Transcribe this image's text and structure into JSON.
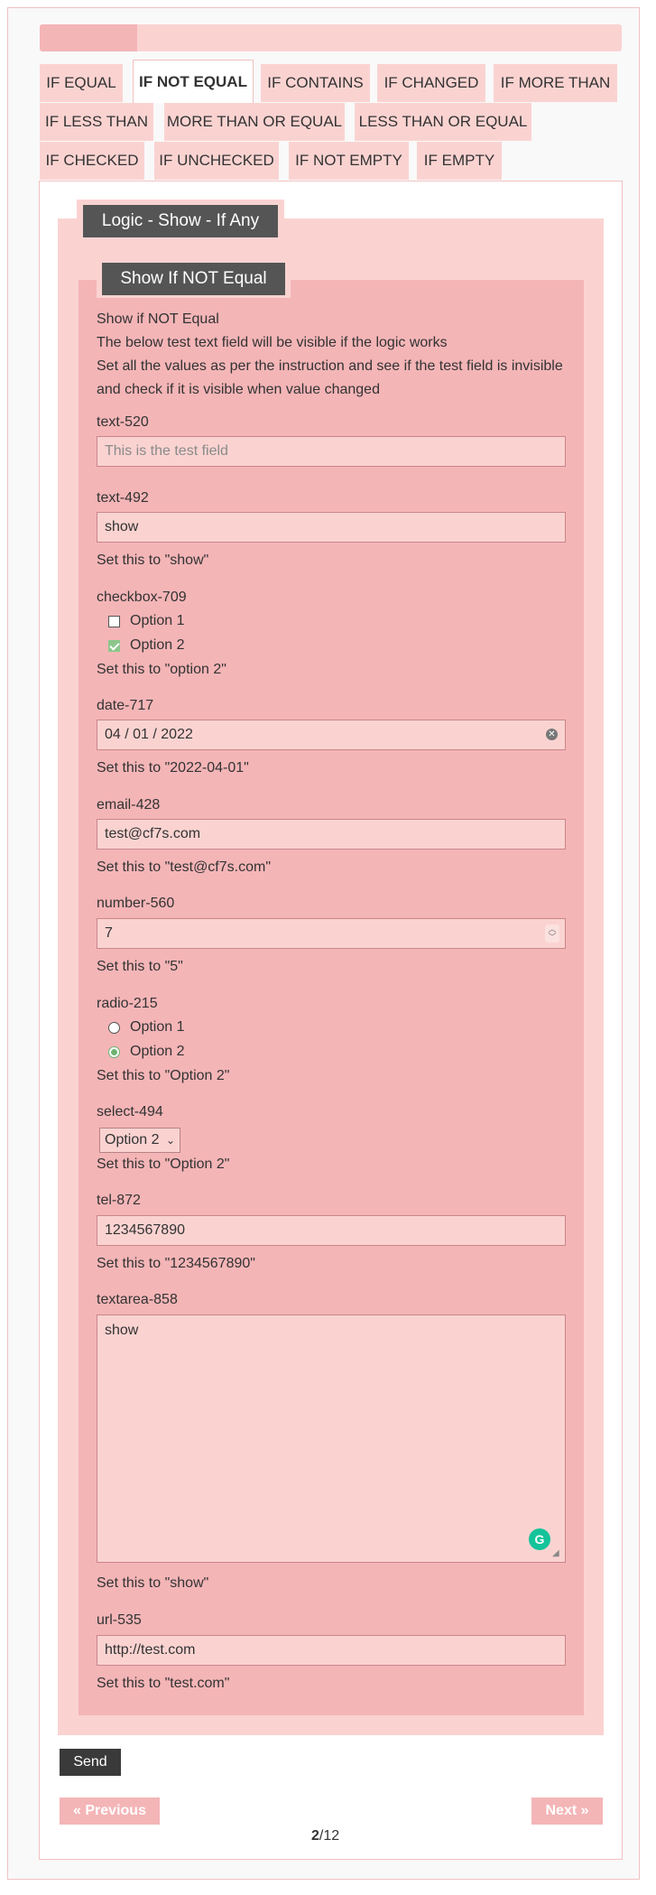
{
  "progress": {
    "percent": 16.7
  },
  "tabs": [
    {
      "label": "IF EQUAL"
    },
    {
      "label": "IF NOT EQUAL"
    },
    {
      "label": "IF CONTAINS"
    },
    {
      "label": "IF CHANGED"
    },
    {
      "label": "IF MORE THAN"
    },
    {
      "label": "IF LESS THAN"
    },
    {
      "label": "MORE THAN OR EQUAL"
    },
    {
      "label": "LESS THAN OR EQUAL"
    },
    {
      "label": "IF CHECKED"
    },
    {
      "label": "IF UNCHECKED"
    },
    {
      "label": "IF NOT EMPTY"
    },
    {
      "label": "IF EMPTY"
    }
  ],
  "active_tab": "IF NOT EQUAL",
  "outer_legend": "Logic - Show - If Any",
  "inner_legend": "Show If NOT Equal",
  "intro": {
    "line1": "Show if NOT Equal",
    "line2": "The below test text field will be visible if the logic works",
    "line3": "Set all the values as per the instruction and see if the test field is invisible",
    "line4": "and check if it is visible when value changed"
  },
  "fields": {
    "text520": {
      "label": "text-520",
      "placeholder": "This is the test field"
    },
    "text492": {
      "label": "text-492",
      "value": "show",
      "hint": "Set this to \"show\""
    },
    "checkbox709": {
      "label": "checkbox-709",
      "option1": "Option 1",
      "option2": "Option 2",
      "hint": "Set this to \"option 2\""
    },
    "date717": {
      "label": "date-717",
      "value": "04 / 01 / 2022",
      "hint": "Set this to \"2022-04-01\""
    },
    "email428": {
      "label": "email-428",
      "value": "test@cf7s.com",
      "hint": "Set this to \"test@cf7s.com\""
    },
    "number560": {
      "label": "number-560",
      "value": "7",
      "hint": "Set this to \"5\""
    },
    "radio215": {
      "label": "radio-215",
      "option1": "Option 1",
      "option2": "Option 2",
      "hint": "Set this to \"Option 2\""
    },
    "select494": {
      "label": "select-494",
      "value": "Option 2",
      "hint": "Set this to \"Option 2\""
    },
    "tel872": {
      "label": "tel-872",
      "value": "1234567890",
      "hint": "Set this to \"1234567890\""
    },
    "textarea858": {
      "label": "textarea-858",
      "value": "show",
      "hint": "Set this to \"show\""
    },
    "url535": {
      "label": "url-535",
      "value": "http://test.com",
      "hint": "Set this to \"test.com\""
    }
  },
  "buttons": {
    "send": "Send",
    "previous": "« Previous",
    "next": "Next »"
  },
  "pager": {
    "current": "2",
    "total": "/12"
  },
  "colors": {
    "light_pink": "#fad3d1",
    "mid_pink": "#f4b5b7",
    "dark_legend": "#555555"
  }
}
